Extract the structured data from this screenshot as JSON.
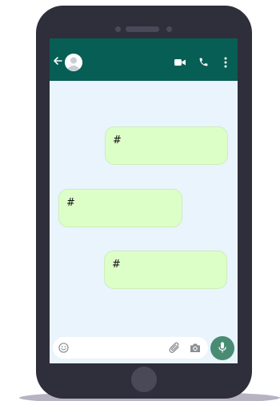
{
  "header": {
    "back_icon": "arrow-left-icon",
    "avatar_icon": "user-avatar-icon",
    "video_icon": "video-camera-icon",
    "call_icon": "phone-icon",
    "menu_icon": "vertical-dots-icon"
  },
  "messages": [
    {
      "side": "right",
      "text": "#"
    },
    {
      "side": "left",
      "text": "#"
    },
    {
      "side": "right",
      "text": "#"
    }
  ],
  "composer": {
    "placeholder": "",
    "emoji_icon": "smiley-icon",
    "attach_icon": "paperclip-icon",
    "camera_icon": "camera-icon",
    "mic_icon": "microphone-icon"
  },
  "colors": {
    "header": "#075e54",
    "chat_background": "#e9f4fd",
    "bubble": "#dcffc8",
    "mic_button": "#4a8b73",
    "phone_body": "#2f2e3b"
  }
}
